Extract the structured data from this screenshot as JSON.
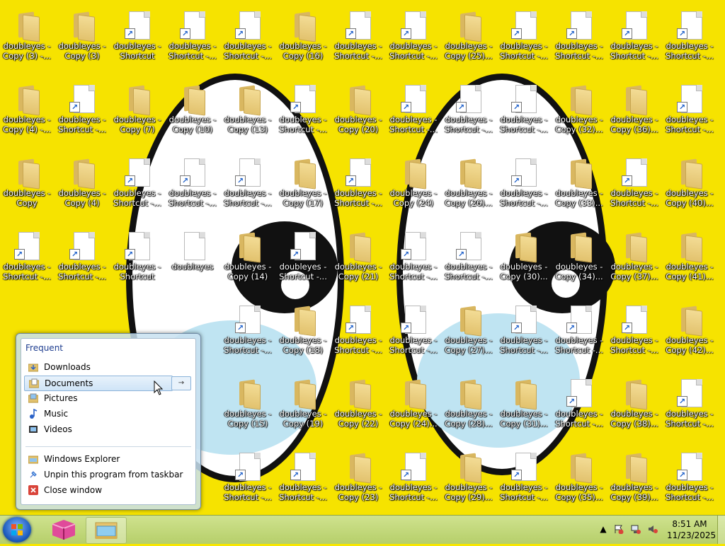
{
  "desktop": {
    "icons": [
      {
        "type": "folder",
        "label": "doubleyes -\nCopy (3) -..."
      },
      {
        "type": "folder",
        "label": "doubleyes -\nCopy (3)"
      },
      {
        "type": "shortcut",
        "label": "doubleyes -\nShortcut"
      },
      {
        "type": "shortcut",
        "label": "doubleyes -\nShortcut -..."
      },
      {
        "type": "shortcut",
        "label": "doubleyes -\nShortcut -..."
      },
      {
        "type": "folder",
        "label": "doubleyes -\nCopy (16)"
      },
      {
        "type": "shortcut",
        "label": "doubleyes -\nShortcut -..."
      },
      {
        "type": "shortcut",
        "label": "doubleyes -\nShortcut -..."
      },
      {
        "type": "folder",
        "label": "doubleyes -\nCopy (25)..."
      },
      {
        "type": "shortcut",
        "label": "doubleyes -\nShortcut -..."
      },
      {
        "type": "shortcut",
        "label": "doubleyes -\nShortcut -..."
      },
      {
        "type": "shortcut",
        "label": "doubleyes -\nShortcut -..."
      },
      {
        "type": "shortcut",
        "label": "doubleyes -\nShortcut -..."
      },
      {
        "type": "folder",
        "label": "doubleyes -\nCopy (4) -..."
      },
      {
        "type": "shortcut",
        "label": "doubleyes -\nShortcut -..."
      },
      {
        "type": "folder",
        "label": "doubleyes -\nCopy (7)"
      },
      {
        "type": "folder",
        "label": "doubleyes -\nCopy (10)"
      },
      {
        "type": "folder",
        "label": "doubleyes -\nCopy (13)"
      },
      {
        "type": "shortcut",
        "label": "doubleyes -\nShortcut -..."
      },
      {
        "type": "folder",
        "label": "doubleyes -\nCopy (20)"
      },
      {
        "type": "shortcut",
        "label": "doubleyes -\nShortcut -..."
      },
      {
        "type": "shortcut",
        "label": "doubleyes -\nShortcut -..."
      },
      {
        "type": "shortcut",
        "label": "doubleyes -\nShortcut -..."
      },
      {
        "type": "folder",
        "label": "doubleyes -\nCopy (32)..."
      },
      {
        "type": "folder",
        "label": "doubleyes -\nCopy (36)..."
      },
      {
        "type": "shortcut",
        "label": "doubleyes -\nShortcut -..."
      },
      {
        "type": "folder",
        "label": "doubleyes -\nCopy"
      },
      {
        "type": "folder",
        "label": "doubleyes -\nCopy (4)"
      },
      {
        "type": "shortcut",
        "label": "doubleyes -\nShortcut -..."
      },
      {
        "type": "shortcut",
        "label": "doubleyes -\nShortcut -..."
      },
      {
        "type": "shortcut",
        "label": "doubleyes -\nShortcut -..."
      },
      {
        "type": "folder",
        "label": "doubleyes -\nCopy (17)"
      },
      {
        "type": "shortcut",
        "label": "doubleyes -\nShortcut -..."
      },
      {
        "type": "folder",
        "label": "doubleyes -\nCopy (24)"
      },
      {
        "type": "folder",
        "label": "doubleyes -\nCopy (26)..."
      },
      {
        "type": "shortcut",
        "label": "doubleyes -\nShortcut -..."
      },
      {
        "type": "folder",
        "label": "doubleyes -\nCopy (33)..."
      },
      {
        "type": "shortcut",
        "label": "doubleyes -\nShortcut -..."
      },
      {
        "type": "folder",
        "label": "doubleyes -\nCopy (40)..."
      },
      {
        "type": "shortcut",
        "label": "doubleyes -\nShortcut -..."
      },
      {
        "type": "shortcut",
        "label": "doubleyes -\nShortcut -..."
      },
      {
        "type": "shortcut",
        "label": "doubleyes -\nShortcut"
      },
      {
        "type": "file",
        "label": "doubleyes"
      },
      {
        "type": "folder",
        "label": "doubleyes -\nCopy (14)"
      },
      {
        "type": "shortcut",
        "label": "doubleyes -\nShortcut -..."
      },
      {
        "type": "folder",
        "label": "doubleyes -\nCopy (21)"
      },
      {
        "type": "shortcut",
        "label": "doubleyes -\nShortcut -..."
      },
      {
        "type": "shortcut",
        "label": "doubleyes -\nShortcut -..."
      },
      {
        "type": "folder",
        "label": "doubleyes -\nCopy (30)..."
      },
      {
        "type": "folder",
        "label": "doubleyes -\nCopy (34)..."
      },
      {
        "type": "folder",
        "label": "doubleyes -\nCopy (37)..."
      },
      {
        "type": "folder",
        "label": "doubleyes -\nCopy (41)..."
      },
      {
        "type": "shortcut",
        "label": "doubleyes -\nShortcut -..."
      },
      {
        "type": "folder",
        "label": "doubleyes -\nCopy (18)"
      },
      {
        "type": "shortcut",
        "label": "doubleyes -\nShortcut -..."
      },
      {
        "type": "shortcut",
        "label": "doubleyes -\nShortcut -..."
      },
      {
        "type": "folder",
        "label": "doubleyes -\nCopy (27)..."
      },
      {
        "type": "shortcut",
        "label": "doubleyes -\nShortcut -..."
      },
      {
        "type": "shortcut",
        "label": "doubleyes -\nShortcut -..."
      },
      {
        "type": "shortcut",
        "label": "doubleyes -\nShortcut -..."
      },
      {
        "type": "folder",
        "label": "doubleyes -\nCopy (42)..."
      },
      {
        "type": "folder",
        "label": "doubleyes -\nCopy (15)"
      },
      {
        "type": "folder",
        "label": "doubleyes -\nCopy (19)"
      },
      {
        "type": "folder",
        "label": "doubleyes -\nCopy (22)"
      },
      {
        "type": "folder",
        "label": "doubleyes -\nCopy (24)..."
      },
      {
        "type": "folder",
        "label": "doubleyes -\nCopy (28)..."
      },
      {
        "type": "folder",
        "label": "doubleyes -\nCopy (31)..."
      },
      {
        "type": "shortcut",
        "label": "doubleyes -\nShortcut -..."
      },
      {
        "type": "folder",
        "label": "doubleyes -\nCopy (38)..."
      },
      {
        "type": "shortcut",
        "label": "doubleyes -\nShortcut -..."
      },
      {
        "type": "shortcut",
        "label": "doubleyes -\nShortcut -..."
      },
      {
        "type": "shortcut",
        "label": "doubleyes -\nShortcut -..."
      },
      {
        "type": "folder",
        "label": "doubleyes -\nCopy (23)"
      },
      {
        "type": "shortcut",
        "label": "doubleyes -\nShortcut -..."
      },
      {
        "type": "folder",
        "label": "doubleyes -\nCopy (29)..."
      },
      {
        "type": "shortcut",
        "label": "doubleyes -\nShortcut -..."
      },
      {
        "type": "folder",
        "label": "doubleyes -\nCopy (35)..."
      },
      {
        "type": "folder",
        "label": "doubleyes -\nCopy (39)..."
      },
      {
        "type": "shortcut",
        "label": "doubleyes -\nShortcut -..."
      }
    ]
  },
  "jumplist": {
    "frequent_header": "Frequent",
    "frequent": [
      {
        "label": "Downloads",
        "icon": "downloads-folder-icon"
      },
      {
        "label": "Documents",
        "icon": "documents-folder-icon",
        "selected": true
      },
      {
        "label": "Pictures",
        "icon": "pictures-folder-icon"
      },
      {
        "label": "Music",
        "icon": "music-folder-icon"
      },
      {
        "label": "Videos",
        "icon": "videos-folder-icon"
      }
    ],
    "tasks": [
      {
        "label": "Windows Explorer",
        "icon": "explorer-icon"
      },
      {
        "label": "Unpin this program from taskbar",
        "icon": "unpin-icon"
      },
      {
        "label": "Close window",
        "icon": "close-window-icon"
      }
    ]
  },
  "taskbar": {
    "clock_time": "8:51 AM",
    "clock_date": "11/23/2025"
  },
  "colors": {
    "wallpaper": "#f6e300",
    "taskbar": "#c3d97c",
    "selection": "#cfe4f7"
  }
}
